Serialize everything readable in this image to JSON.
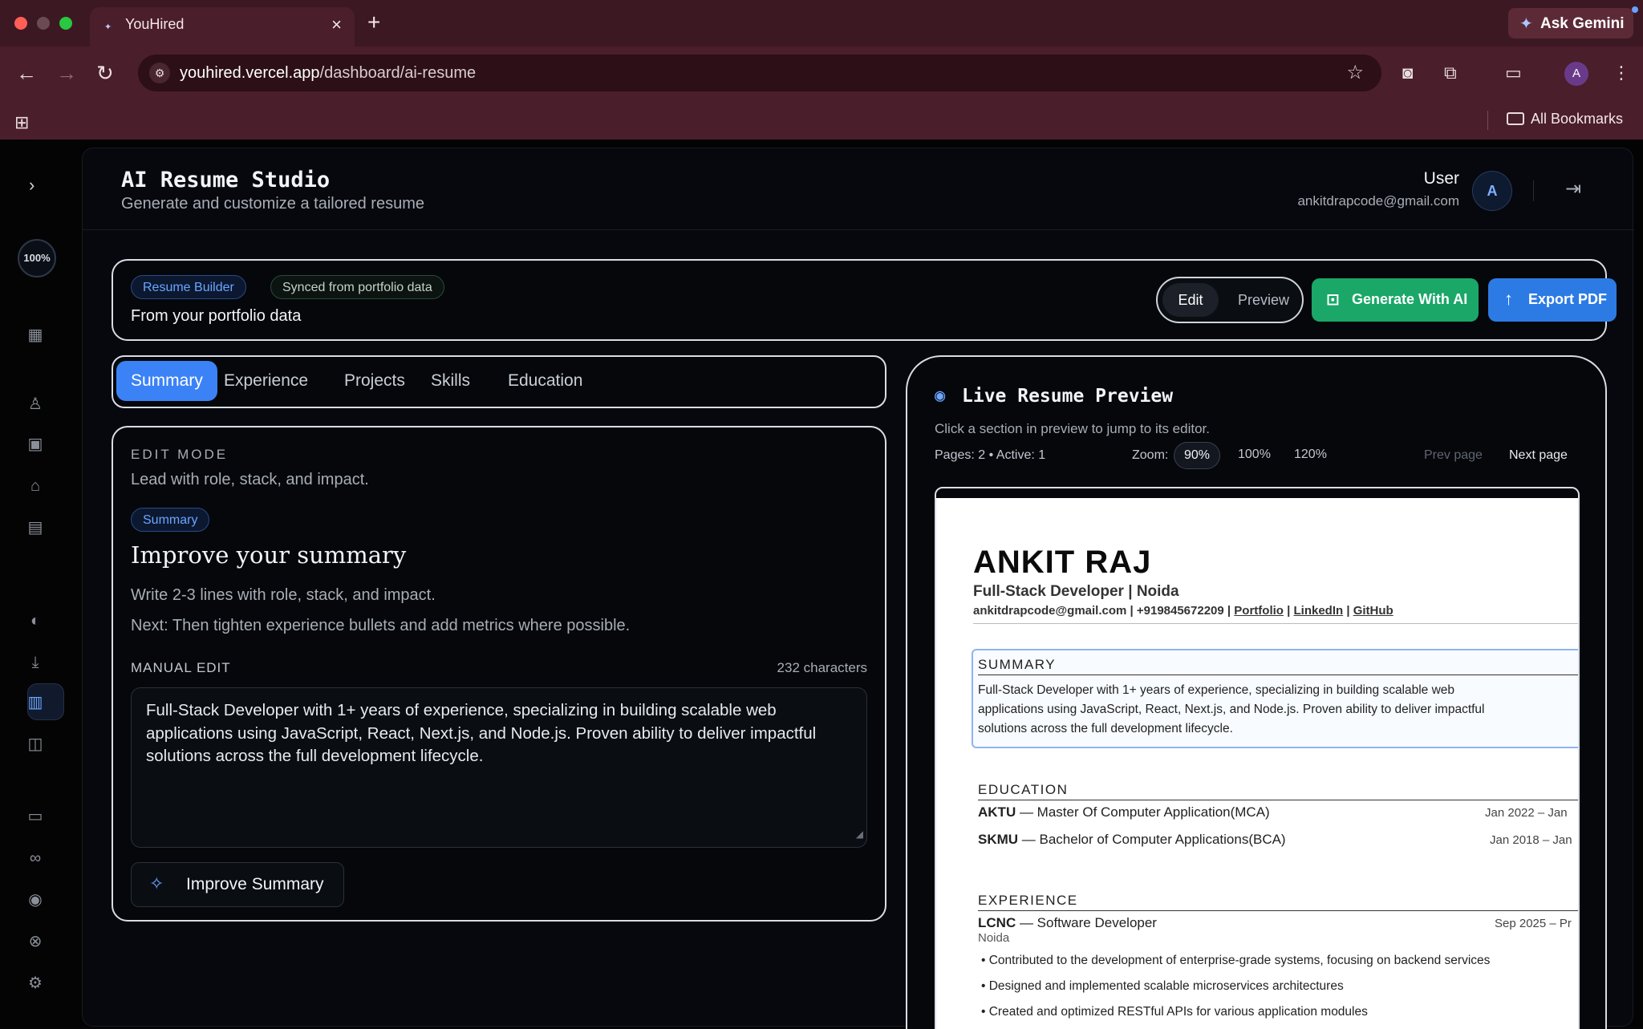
{
  "browser": {
    "tab_title": "YouHired",
    "url_host": "youhired.vercel.app",
    "url_path": "/dashboard/ai-resume",
    "gemini_label": "Ask Gemini",
    "profile_initial": "A",
    "all_bookmarks": "All Bookmarks"
  },
  "sidebar": {
    "progress": "100%"
  },
  "header": {
    "title": "AI Resume Studio",
    "subtitle": "Generate and customize a tailored resume",
    "user_name": "User",
    "user_email": "ankitdrapcode@gmail.com",
    "avatar_initial": "A"
  },
  "toolbar": {
    "badge_builder": "Resume Builder",
    "badge_synced": "Synced from portfolio data",
    "source_text": "From your portfolio data",
    "mode_edit": "Edit",
    "mode_preview": "Preview",
    "generate_label": "Generate With AI",
    "export_label": "Export PDF"
  },
  "tabs": [
    "Summary",
    "Experience",
    "Projects",
    "Skills",
    "Education"
  ],
  "editor": {
    "mode_label": "EDIT MODE",
    "mode_hint": "Lead with role, stack, and impact.",
    "section_badge": "Summary",
    "heading": "Improve your summary",
    "tip1": "Write 2-3 lines with role, stack, and impact.",
    "tip2": "Next: Then tighten experience bullets and add metrics where possible.",
    "manual_label": "MANUAL EDIT",
    "char_count": "232 characters",
    "summary_text": "Full-Stack Developer with 1+ years of experience, specializing in building scalable web applications using JavaScript, React, Next.js, and Node.js. Proven ability to deliver impactful solutions across the full development lifecycle.",
    "improve_label": "Improve Summary"
  },
  "preview": {
    "title": "Live Resume Preview",
    "subtitle": "Click a section in preview to jump to its editor.",
    "pages": "Pages: 2 • Active: 1",
    "zoom_label": "Zoom:",
    "zoom_options": [
      "90%",
      "100%",
      "120%"
    ],
    "zoom_selected": "90%",
    "prev_page": "Prev page",
    "next_page": "Next page"
  },
  "resume": {
    "name": "ANKIT RAJ",
    "role": "Full-Stack Developer | Noida",
    "contact_text": "ankitdrapcode@gmail.com | +919845672209 |",
    "link_portfolio": "Portfolio",
    "link_linkedin": "LinkedIn",
    "link_github": "GitHub",
    "summary_heading": "SUMMARY",
    "summary_l1": "Full-Stack Developer with 1+ years of experience, specializing in building scalable web",
    "summary_l2": "applications using JavaScript, React, Next.js, and Node.js. Proven ability to deliver impactful",
    "summary_l3": "solutions across the full development lifecycle.",
    "education_heading": "EDUCATION",
    "edu1_school": "AKTU",
    "edu1_degree": " — Master Of Computer Application(MCA)",
    "edu1_date": "Jan 2022 – Jan",
    "edu2_school": "SKMU",
    "edu2_degree": " — Bachelor of Computer Applications(BCA)",
    "edu2_date": "Jan 2018 – Jan",
    "experience_heading": "EXPERIENCE",
    "exp1_company": "LCNC",
    "exp1_role": " — Software Developer",
    "exp1_location": "Noida",
    "exp1_date": "Sep 2025 – Pr",
    "exp1_b1": "Contributed to the development of enterprise-grade systems, focusing on backend services",
    "exp1_b2": "Designed and implemented scalable microservices architectures",
    "exp1_b3": "Created and optimized RESTful APIs for various application modules"
  }
}
